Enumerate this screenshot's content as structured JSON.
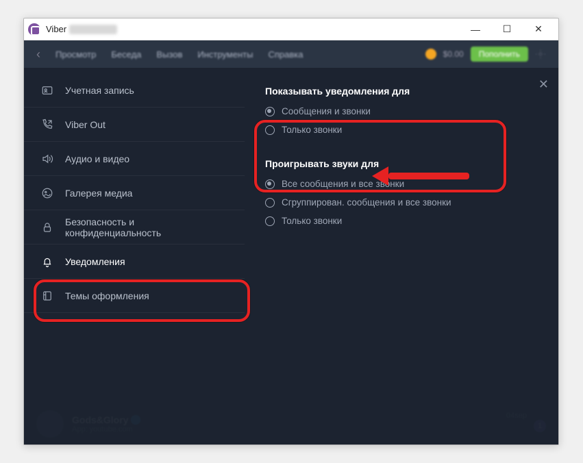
{
  "title": "Viber",
  "topmenu": {
    "items": [
      "Просмотр",
      "Беседа",
      "Вызов",
      "Инструменты",
      "Справка"
    ],
    "balance": "$0.00",
    "topup": "Пополнить"
  },
  "sidebar": {
    "items": [
      {
        "label": "Учетная запись"
      },
      {
        "label": "Viber Out"
      },
      {
        "label": "Аудио и видео"
      },
      {
        "label": "Галерея медиа"
      },
      {
        "label": "Безопасность и конфиденциальность"
      },
      {
        "label": "Уведомления"
      },
      {
        "label": "Темы оформления"
      }
    ],
    "active": 5
  },
  "content": {
    "section1": {
      "title": "Показывать уведомления для",
      "options": [
        {
          "label": "Сообщения и звонки",
          "checked": true
        },
        {
          "label": "Только звонки",
          "checked": false
        }
      ]
    },
    "section2": {
      "title": "Проигрывать звуки для",
      "options": [
        {
          "label": "Все сообщения и все звонки",
          "checked": true
        },
        {
          "label": "Сгруппирован. сообщения и все звонки",
          "checked": false
        },
        {
          "label": "Только звонки",
          "checked": false
        }
      ]
    }
  },
  "chat": {
    "name": "Gods&Glory",
    "sub": "App: youtube.com",
    "time": "04sep",
    "badge": "1"
  }
}
